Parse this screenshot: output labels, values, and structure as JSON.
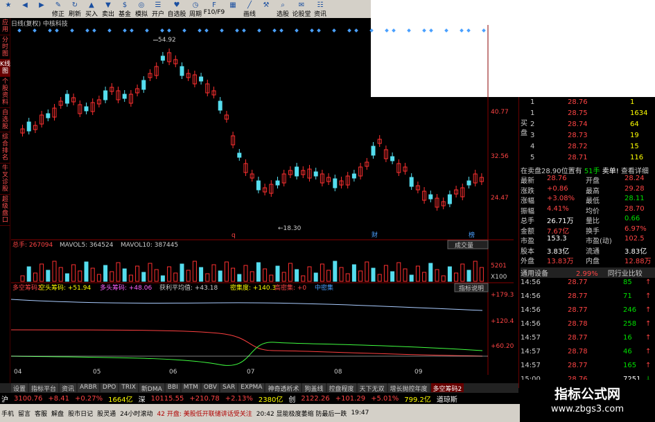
{
  "toolbar": {
    "items": [
      {
        "label": "",
        "icon": "star-icon"
      },
      {
        "label": "",
        "icon": "back-arrow-icon"
      },
      {
        "label": "",
        "icon": "forward-arrow-icon"
      },
      {
        "label": "修正",
        "icon": "edit-icon"
      },
      {
        "label": "刷新",
        "icon": "refresh-icon"
      },
      {
        "label": "买入",
        "icon": "buy-icon"
      },
      {
        "label": "卖出",
        "icon": "sell-icon"
      },
      {
        "label": "基金",
        "icon": "fund-icon"
      },
      {
        "label": "模拟",
        "icon": "simulate-icon"
      },
      {
        "label": "开户",
        "icon": "account-icon"
      },
      {
        "label": "自选股",
        "icon": "watchlist-icon"
      },
      {
        "label": "周期",
        "icon": "period-icon"
      },
      {
        "label": "F10/F9",
        "icon": "f10-icon"
      },
      {
        "label": "",
        "icon": "chart-icon"
      },
      {
        "label": "画线",
        "icon": "draw-line-icon"
      },
      {
        "label": "",
        "icon": "tool-icon"
      },
      {
        "label": "选股",
        "icon": "select-stock-icon"
      },
      {
        "label": "论股堂",
        "icon": "forum-icon"
      },
      {
        "label": "资讯",
        "icon": "news-icon"
      }
    ]
  },
  "left_tabs": [
    "应用",
    "分时图",
    "K线图",
    "个股资料",
    "自选股",
    "综合排名",
    "牛叉诊股",
    "超级盘口"
  ],
  "chart": {
    "title": "日线(复权)  中核科技",
    "price_high_label": "54.92",
    "price_low_label": "18.30",
    "price_ticks": [
      "40.77",
      "32.56",
      "24.47"
    ],
    "markers": [
      "q",
      "财",
      "榜"
    ],
    "volume_label": "总手: 267094",
    "mavol5": "MAVOL5: 364524",
    "mavol10": "MAVOL10: 387445",
    "volume_button": "成交量",
    "volume_ticks": [
      "5201",
      "X100"
    ],
    "indicator_labels": [
      "多空筹码2",
      "空头筹码: +51.94",
      "多头筹码: +48.06",
      "获利平均值: +43.18",
      "密集度: +140.3",
      "高密集: +0",
      "中密集"
    ],
    "indicator_button": "指标说明",
    "indicator_ticks": [
      "+179.3",
      "+120.4",
      "+60.20"
    ],
    "months": [
      "04",
      "05",
      "06",
      "07",
      "08",
      "09"
    ]
  },
  "quote": {
    "buy_side_label": "买盘",
    "buy": [
      {
        "n": "1",
        "price": "28.76",
        "vol": "1"
      },
      {
        "n": "1",
        "price": "28.75",
        "vol": "1634"
      },
      {
        "n": "2",
        "price": "28.74",
        "vol": "64"
      },
      {
        "n": "3",
        "price": "28.73",
        "vol": "19"
      },
      {
        "n": "4",
        "price": "28.72",
        "vol": "15"
      },
      {
        "n": "5",
        "price": "28.71",
        "vol": "116"
      }
    ],
    "status_line": "在卖盘28.90位置有",
    "status_qty": "51手",
    "status_sell": "卖单!",
    "status_detail": "查看详细",
    "stats": [
      {
        "l1": "最新",
        "v1": "28.76",
        "l2": "开盘",
        "v2": "28.24"
      },
      {
        "l1": "涨跌",
        "v1": "+0.86",
        "l2": "最高",
        "v2": "29.28"
      },
      {
        "l1": "涨幅",
        "v1": "+3.08%",
        "l2": "最低",
        "v2": "28.11"
      },
      {
        "l1": "振幅",
        "v1": "4.41%",
        "l2": "均价",
        "v2": "28.70"
      },
      {
        "l1": "总手",
        "v1": "26.71万",
        "l2": "量比",
        "v2": "0.66"
      },
      {
        "l1": "金额",
        "v1": "7.67亿",
        "l2": "换手",
        "v2": "6.97%"
      },
      {
        "l1": "市盈",
        "v1": "153.3",
        "l2": "市盈(动)",
        "v2": "102.5"
      },
      {
        "l1": "股本",
        "v1": "3.83亿",
        "l2": "流通",
        "v2": "3.83亿"
      },
      {
        "l1": "外盘",
        "v1": "13.83万",
        "l2": "内盘",
        "v2": "12.88万"
      }
    ],
    "sector": {
      "name": "通用设备",
      "pct": "2.99%",
      "button": "同行业比较"
    },
    "ticks": [
      {
        "t": "14:56",
        "p": "28.77",
        "v": "85",
        "dir": "up"
      },
      {
        "t": "14:56",
        "p": "28.77",
        "v": "71",
        "dir": "up"
      },
      {
        "t": "14:56",
        "p": "28.77",
        "v": "246",
        "dir": "up"
      },
      {
        "t": "14:56",
        "p": "28.78",
        "v": "258",
        "dir": "up"
      },
      {
        "t": "14:57",
        "p": "28.77",
        "v": "16",
        "dir": "up"
      },
      {
        "t": "14:57",
        "p": "28.78",
        "v": "46",
        "dir": "up"
      },
      {
        "t": "14:57",
        "p": "28.77",
        "v": "165",
        "dir": "up"
      },
      {
        "t": "15:00",
        "p": "28.76",
        "v": "7251",
        "dir": "down"
      }
    ]
  },
  "bottom_tabs": [
    "设置",
    "指标平台",
    "资讯",
    "ARBR",
    "DPO",
    "TRIX",
    "新DMA",
    "BBI",
    "MTM",
    "OBV",
    "SAR",
    "EXPMA",
    "神奇透析术",
    "狗盖线",
    "控盘程度",
    "天下无双",
    "增长抛控年度",
    "多空筹码2"
  ],
  "index_bar": [
    {
      "text": "沪",
      "c": "white"
    },
    {
      "text": "3100.76",
      "c": "red"
    },
    {
      "text": "+8.41",
      "c": "red"
    },
    {
      "text": "+0.27%",
      "c": "red"
    },
    {
      "text": "1664亿",
      "c": "yel"
    },
    {
      "text": "深",
      "c": "white"
    },
    {
      "text": "10115.55",
      "c": "red"
    },
    {
      "text": "+210.78",
      "c": "red"
    },
    {
      "text": "+2.13%",
      "c": "red"
    },
    {
      "text": "2380亿",
      "c": "yel"
    },
    {
      "text": "创",
      "c": "white"
    },
    {
      "text": "2122.26",
      "c": "red"
    },
    {
      "text": "+101.29",
      "c": "red"
    },
    {
      "text": "+5.01%",
      "c": "red"
    },
    {
      "text": "799.2亿",
      "c": "yel"
    },
    {
      "text": "道琼斯",
      "c": "white"
    }
  ],
  "news_bar": [
    "手机",
    "留言",
    "客服",
    "解盘",
    "股市日记",
    "股灵通",
    "24小时滚动",
    "42 开盘: 美股低开联储讲话受关注",
    "20:42 显能极度萎缩 防最后一跌",
    "19:47"
  ],
  "watermark": {
    "title": "指标公式网",
    "url": "www.zbgs3.com"
  }
}
